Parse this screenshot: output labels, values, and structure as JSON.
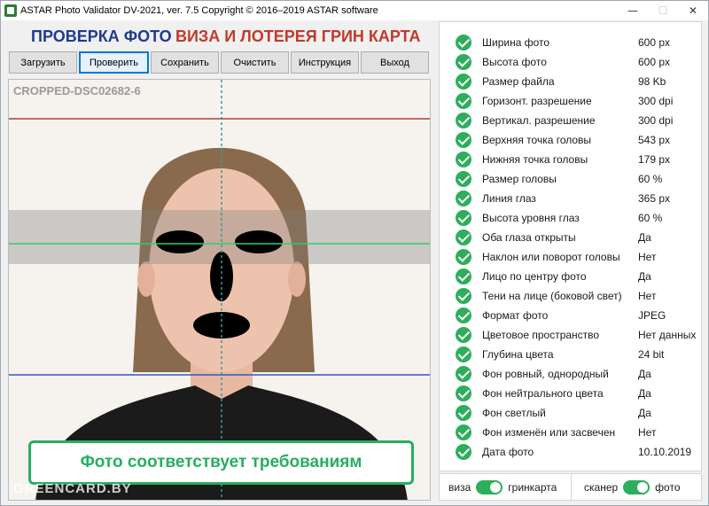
{
  "window": {
    "title": "ASTAR Photo Validator DV-2021, ver. 7.5  Copyright © 2016–2019 ASTAR software",
    "controls": {
      "minimize": "—",
      "maximize": "☐",
      "close": "✕"
    }
  },
  "header": {
    "title_left": "ПРОВЕРКА ФОТО",
    "title_right": "ВИЗА И ЛОТЕРЕЯ ГРИН КАРТА",
    "colors": {
      "left": "#1e3a8f",
      "right": "#c0392b"
    }
  },
  "toolbar": {
    "buttons": [
      "Загрузить",
      "Проверить",
      "Сохранить",
      "Очистить",
      "Инструкция",
      "Выход"
    ],
    "active": "Проверить"
  },
  "photo": {
    "file_name": "CROPPED-DSC02682-6",
    "watermark": "GREENCARD.BY",
    "result": "Фото соответствует требованиям",
    "guide_colors": {
      "top": "#b03a3a",
      "eyes": "#2ecc71",
      "chin": "#2e56c9",
      "center": "#2f9e9e"
    }
  },
  "checks": [
    {
      "label": "Ширина фото",
      "value": "600 px",
      "status": "ok"
    },
    {
      "label": "Высота фото",
      "value": "600 px",
      "status": "ok"
    },
    {
      "label": "Размер файла",
      "value": "98 Kb",
      "status": "ok"
    },
    {
      "label": "Горизонт. разрешение",
      "value": "300 dpi",
      "status": "ok"
    },
    {
      "label": "Вертикал. разрешение",
      "value": "300 dpi",
      "status": "ok"
    },
    {
      "label": "Верхняя точка головы",
      "value": "543 px",
      "status": "ok"
    },
    {
      "label": "Нижняя точка головы",
      "value": "179 px",
      "status": "ok"
    },
    {
      "label": "Размер головы",
      "value": "60 %",
      "status": "ok"
    },
    {
      "label": "Линия глаз",
      "value": "365 px",
      "status": "ok"
    },
    {
      "label": "Высота уровня глаз",
      "value": "60 %",
      "status": "ok"
    },
    {
      "label": "Оба глаза открыты",
      "value": "Да",
      "status": "ok"
    },
    {
      "label": "Наклон или поворот головы",
      "value": "Нет",
      "status": "ok"
    },
    {
      "label": "Лицо по центру фото",
      "value": "Да",
      "status": "ok"
    },
    {
      "label": "Тени на лице (боковой свет)",
      "value": "Нет",
      "status": "ok"
    },
    {
      "label": "Формат фото",
      "value": "JPEG",
      "status": "ok"
    },
    {
      "label": "Цветовое пространство",
      "value": "Нет данных",
      "status": "ok"
    },
    {
      "label": "Глубина цвета",
      "value": "24 bit",
      "status": "ok"
    },
    {
      "label": "Фон ровный, однородный",
      "value": "Да",
      "status": "ok"
    },
    {
      "label": "Фон нейтрального цвета",
      "value": "Да",
      "status": "ok"
    },
    {
      "label": "Фон светлый",
      "value": "Да",
      "status": "ok"
    },
    {
      "label": "Фон изменён или засвечен",
      "value": "Нет",
      "status": "ok"
    },
    {
      "label": "Дата фото",
      "value": "10.10.2019",
      "status": "ok"
    }
  ],
  "check_icon": "check-circle-icon",
  "accent_color": "#2eae5c",
  "toggles": {
    "mode": {
      "left": "виза",
      "right": "гринкарта",
      "state": "right"
    },
    "source": {
      "left": "сканер",
      "right": "фото",
      "state": "right"
    }
  }
}
